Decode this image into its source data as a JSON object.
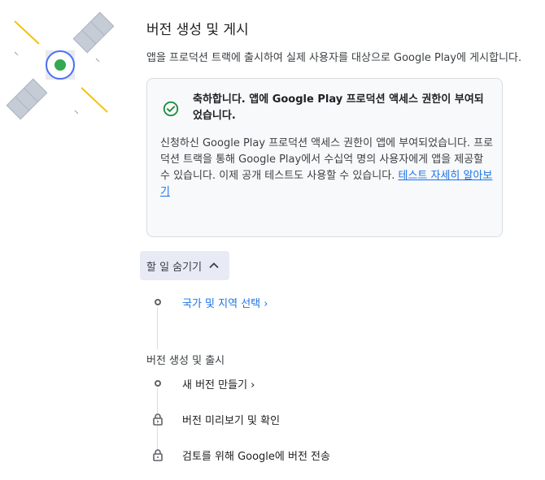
{
  "page": {
    "title": "버전 생성 및 게시",
    "subtitle": "앱을 프로덕션 트랙에 출시하여 실제 사용자를 대상으로 Google Play에 게시합니다."
  },
  "card": {
    "heading": "축하합니다. 앱에 Google Play 프로덕션 액세스 권한이 부여되었습니다.",
    "body": "신청하신 Google Play 프로덕션 액세스 권한이 앱에 부여되었습니다. 프로덕션 트랙을 통해 Google Play에서 수십억 명의 사용자에게 앱을 제공할 수 있습니다. 이제 공개 테스트도 사용할 수 있습니다. ",
    "link": "테스트 자세히 알아보기"
  },
  "tasks": {
    "hide_label": "할 일 숨기기",
    "country_label": "국가 및 지역 선택 ›",
    "section_title": "버전 생성 및 출시",
    "new_release_label": "새 버전 만들기 ›",
    "preview_label": "버전 미리보기 및 확인",
    "send_label": "검토를 위해 Google에 버전 전송"
  },
  "colors": {
    "accent": "#1a73e8",
    "success": "#1e8e3e",
    "illustration_dot": "#34a853",
    "illustration_ring": "#4c6ef5"
  },
  "icons": {
    "success": "check-circle-icon",
    "chevron": "chevron-up-icon",
    "pending": "circle-outline-icon",
    "locked": "lock-icon"
  }
}
